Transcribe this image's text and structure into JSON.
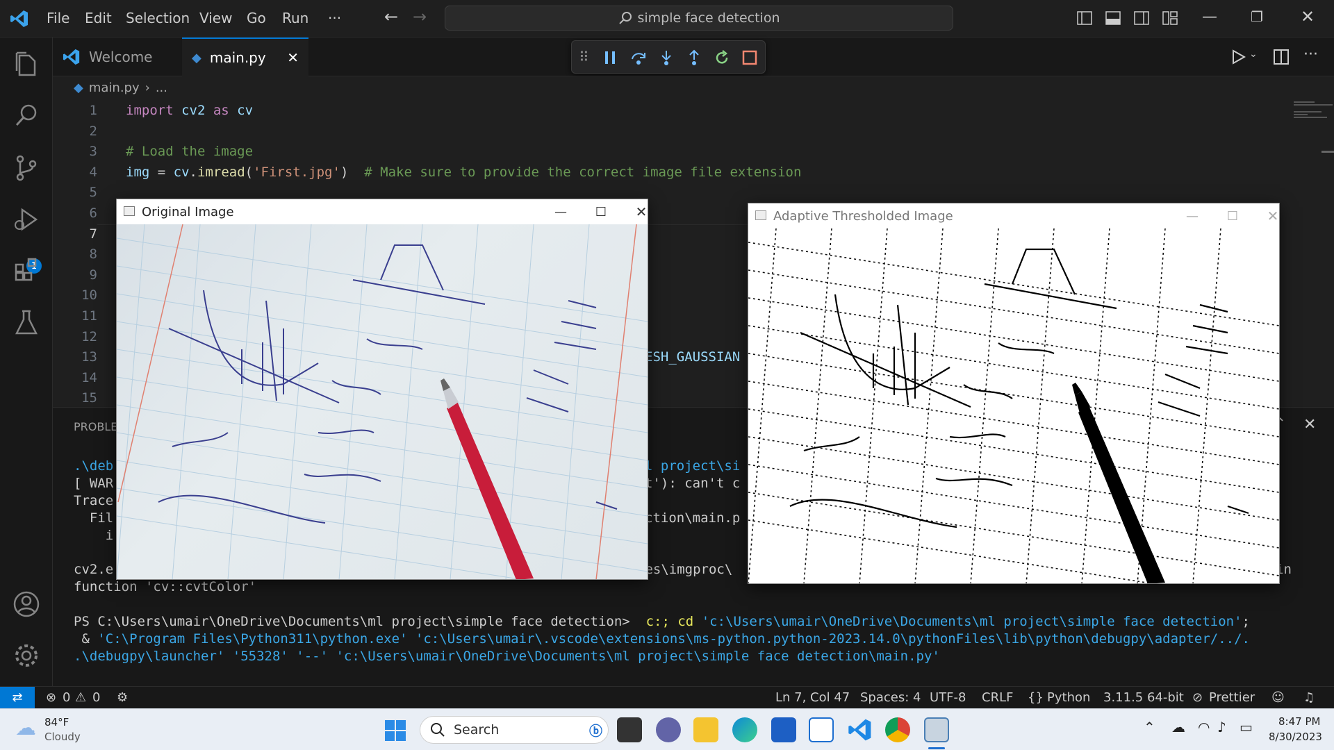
{
  "menu": {
    "items": [
      "File",
      "Edit",
      "Selection",
      "View",
      "Go",
      "Run",
      "···"
    ]
  },
  "command_center": {
    "text": "simple face detection"
  },
  "tabs": [
    {
      "label": "Welcome"
    },
    {
      "label": "main.py"
    }
  ],
  "breadcrumb": {
    "file": "main.py",
    "rest": "..."
  },
  "activity_badge": "1",
  "editor": {
    "line_numbers": [
      "1",
      "2",
      "3",
      "4",
      "5",
      "6",
      "7",
      "8",
      "9",
      "10",
      "11",
      "12",
      "13",
      "14",
      "15"
    ],
    "line1": {
      "kw1": "import",
      "mod": " cv2 ",
      "kw2": "as",
      "alias": " cv"
    },
    "line3": "# Load the image",
    "line4": {
      "var": "img",
      "eq": " = ",
      "obj": "cv",
      "dot": ".",
      "fn": "imread",
      "p1": "(",
      "str": "'First.jpg'",
      "p2": ")",
      "comment": "  # Make sure to provide the correct image file extension"
    },
    "line13_tail": "ESH_GAUSSIAN"
  },
  "panel": {
    "tab_partial": "PROBLE",
    "lines": [
      {
        "left": ".\\deb",
        "right": "l project\\si"
      },
      {
        "left": "[ WAR",
        "right": "t'): can't c"
      },
      {
        "left": "Trace",
        "right": ""
      },
      {
        "left": "  Fil",
        "right": "ction\\main.p"
      },
      {
        "left": "    i",
        "right": ""
      },
      {
        "left": "cv2.e",
        "right": "les\\imgproc\\"
      },
      {
        "left": "function 'cv::cvtColor'",
        "right": ""
      }
    ],
    "line6_end": "in",
    "prompt": "PS C:\\Users\\umair\\OneDrive\\Documents\\ml project\\simple face detection>",
    "cmd1_a": "  c:; cd ",
    "cmd1_b": "'c:\\Users\\umair\\OneDrive\\Documents\\ml project\\simple face detection'",
    "cmd1_c": ";",
    "cmd2_a": " & ",
    "cmd2_b": "'C:\\Program Files\\Python311\\python.exe' 'c:\\Users\\umair\\.vscode\\extensions\\ms-python.python-2023.14.0\\pythonFiles\\lib\\python\\debugpy\\adapter/../.",
    "cmd3": ".\\debugpy\\launcher' '55328' '--' 'c:\\Users\\umair\\OneDrive\\Documents\\ml project\\simple face detection\\main.py'"
  },
  "windows": {
    "original": {
      "title": "Original Image"
    },
    "threshold": {
      "title": "Adaptive Thresholded Image"
    }
  },
  "status": {
    "errors": "0",
    "warnings": "0",
    "position": "Ln 7, Col 47",
    "spaces": "Spaces: 4",
    "encoding": "UTF-8",
    "eol": "CRLF",
    "language": "Python",
    "interpreter": "3.11.5 64-bit",
    "formatter": "Prettier"
  },
  "taskbar": {
    "weather_temp": "84°F",
    "weather_desc": "Cloudy",
    "search": "Search",
    "time": "8:47 PM",
    "date": "8/30/2023"
  },
  "colors": {
    "accent": "#007acc",
    "keyword": "#c586c0",
    "comment": "#6a9955",
    "string": "#ce9178",
    "terminal_path": "#3ba7e6"
  }
}
